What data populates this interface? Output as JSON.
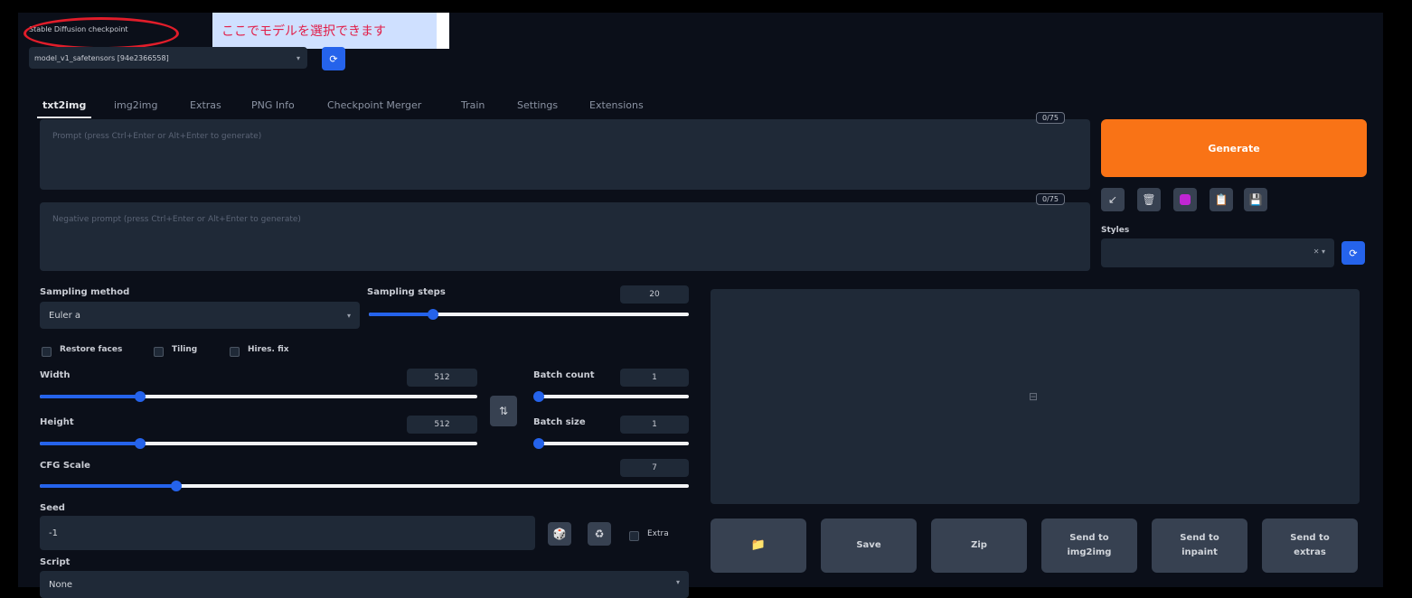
{
  "checkpoint": {
    "label": "Stable Diffusion checkpoint",
    "selected": "model_v1_safetensors [94e2366558]",
    "annotation": "ここでモデルを選択できます"
  },
  "tabs": [
    "txt2img",
    "img2img",
    "Extras",
    "PNG Info",
    "Checkpoint Merger",
    "Train",
    "Settings",
    "Extensions"
  ],
  "prompt": {
    "placeholder": "Prompt (press Ctrl+Enter or Alt+Enter to generate)",
    "token_count": "0/75"
  },
  "negative_prompt": {
    "placeholder": "Negative prompt (press Ctrl+Enter or Alt+Enter to generate)",
    "token_count": "0/75"
  },
  "generate_label": "Generate",
  "styles_label": "Styles",
  "sampling": {
    "method_label": "Sampling method",
    "method_value": "Euler a",
    "steps_label": "Sampling steps",
    "steps_value": "20",
    "steps_fraction": 0.2
  },
  "options": {
    "restore_faces": "Restore faces",
    "tiling": "Tiling",
    "hires_fix": "Hires. fix"
  },
  "width": {
    "label": "Width",
    "value": "512",
    "fraction": 0.23
  },
  "height": {
    "label": "Height",
    "value": "512",
    "fraction": 0.23
  },
  "batch_count": {
    "label": "Batch count",
    "value": "1",
    "fraction": 0.0
  },
  "batch_size": {
    "label": "Batch size",
    "value": "1",
    "fraction": 0.0
  },
  "cfg": {
    "label": "CFG Scale",
    "value": "7",
    "fraction": 0.21
  },
  "seed": {
    "label": "Seed",
    "value": "-1",
    "extra_label": "Extra"
  },
  "script": {
    "label": "Script",
    "value": "None"
  },
  "output_buttons": {
    "folder_icon": "folder-icon",
    "save": "Save",
    "zip": "Zip",
    "send_img2img": [
      "Send to",
      "img2img"
    ],
    "send_inpaint": [
      "Send to",
      "inpaint"
    ],
    "send_extras": [
      "Send to",
      "extras"
    ]
  },
  "colors": {
    "background": "#0b0f19",
    "generate": "#f97316",
    "accent": "#2563eb",
    "annotation_text": "#e11d48",
    "annotation_bg": "#cfe0ff",
    "annotation_ring": "#e11d2a"
  }
}
